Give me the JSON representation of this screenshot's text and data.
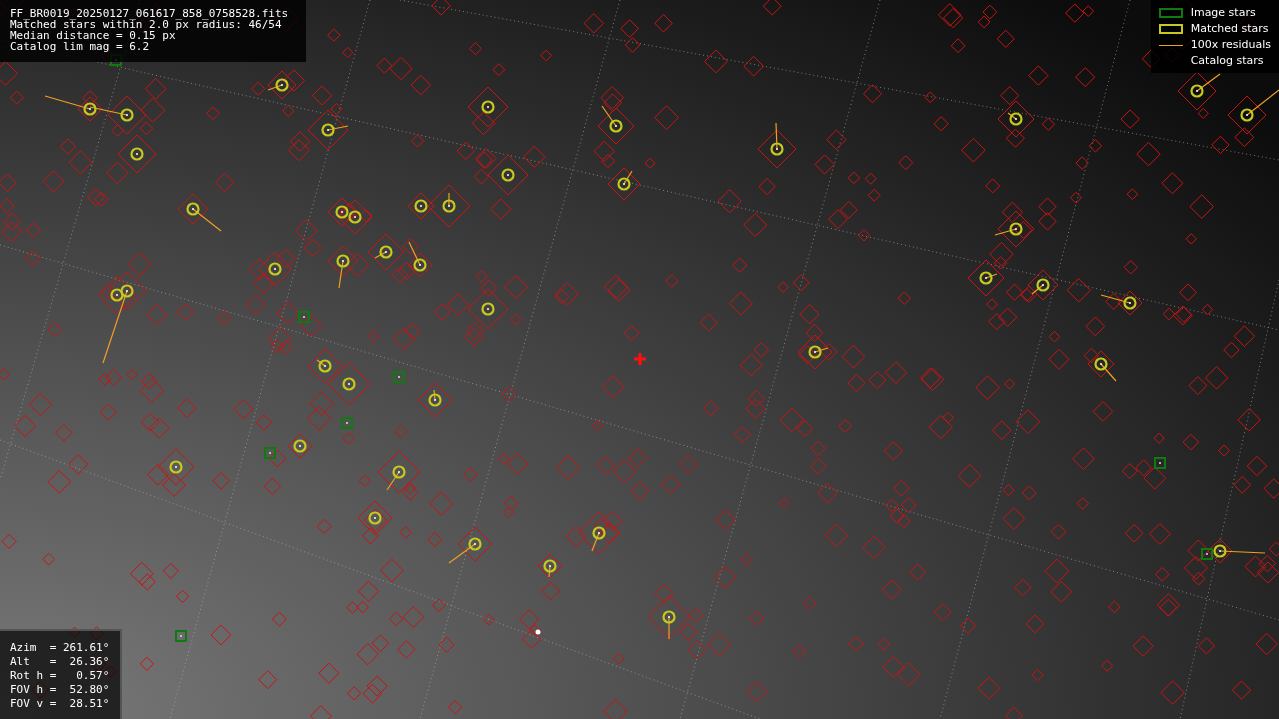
{
  "file_info": {
    "lines": [
      "FF_BR0019_20250127_061617_858_0758528.fits",
      "Matched stars within 2.0 px radius: 46/54",
      "Median distance = 0.15 px",
      "Catalog lim mag = 6.2"
    ]
  },
  "legend": [
    {
      "kind": "image",
      "label": "Image stars"
    },
    {
      "kind": "matched",
      "label": "Matched stars"
    },
    {
      "kind": "residual",
      "label": "100x residuals"
    },
    {
      "kind": "catalog",
      "label": "Catalog stars"
    }
  ],
  "pointing": {
    "lines": [
      "Azim  = 261.61°",
      "Alt   =  26.36°",
      "Rot h =   0.57°",
      "FOV h =  52.80°",
      "FOV v =  28.51°"
    ]
  }
}
